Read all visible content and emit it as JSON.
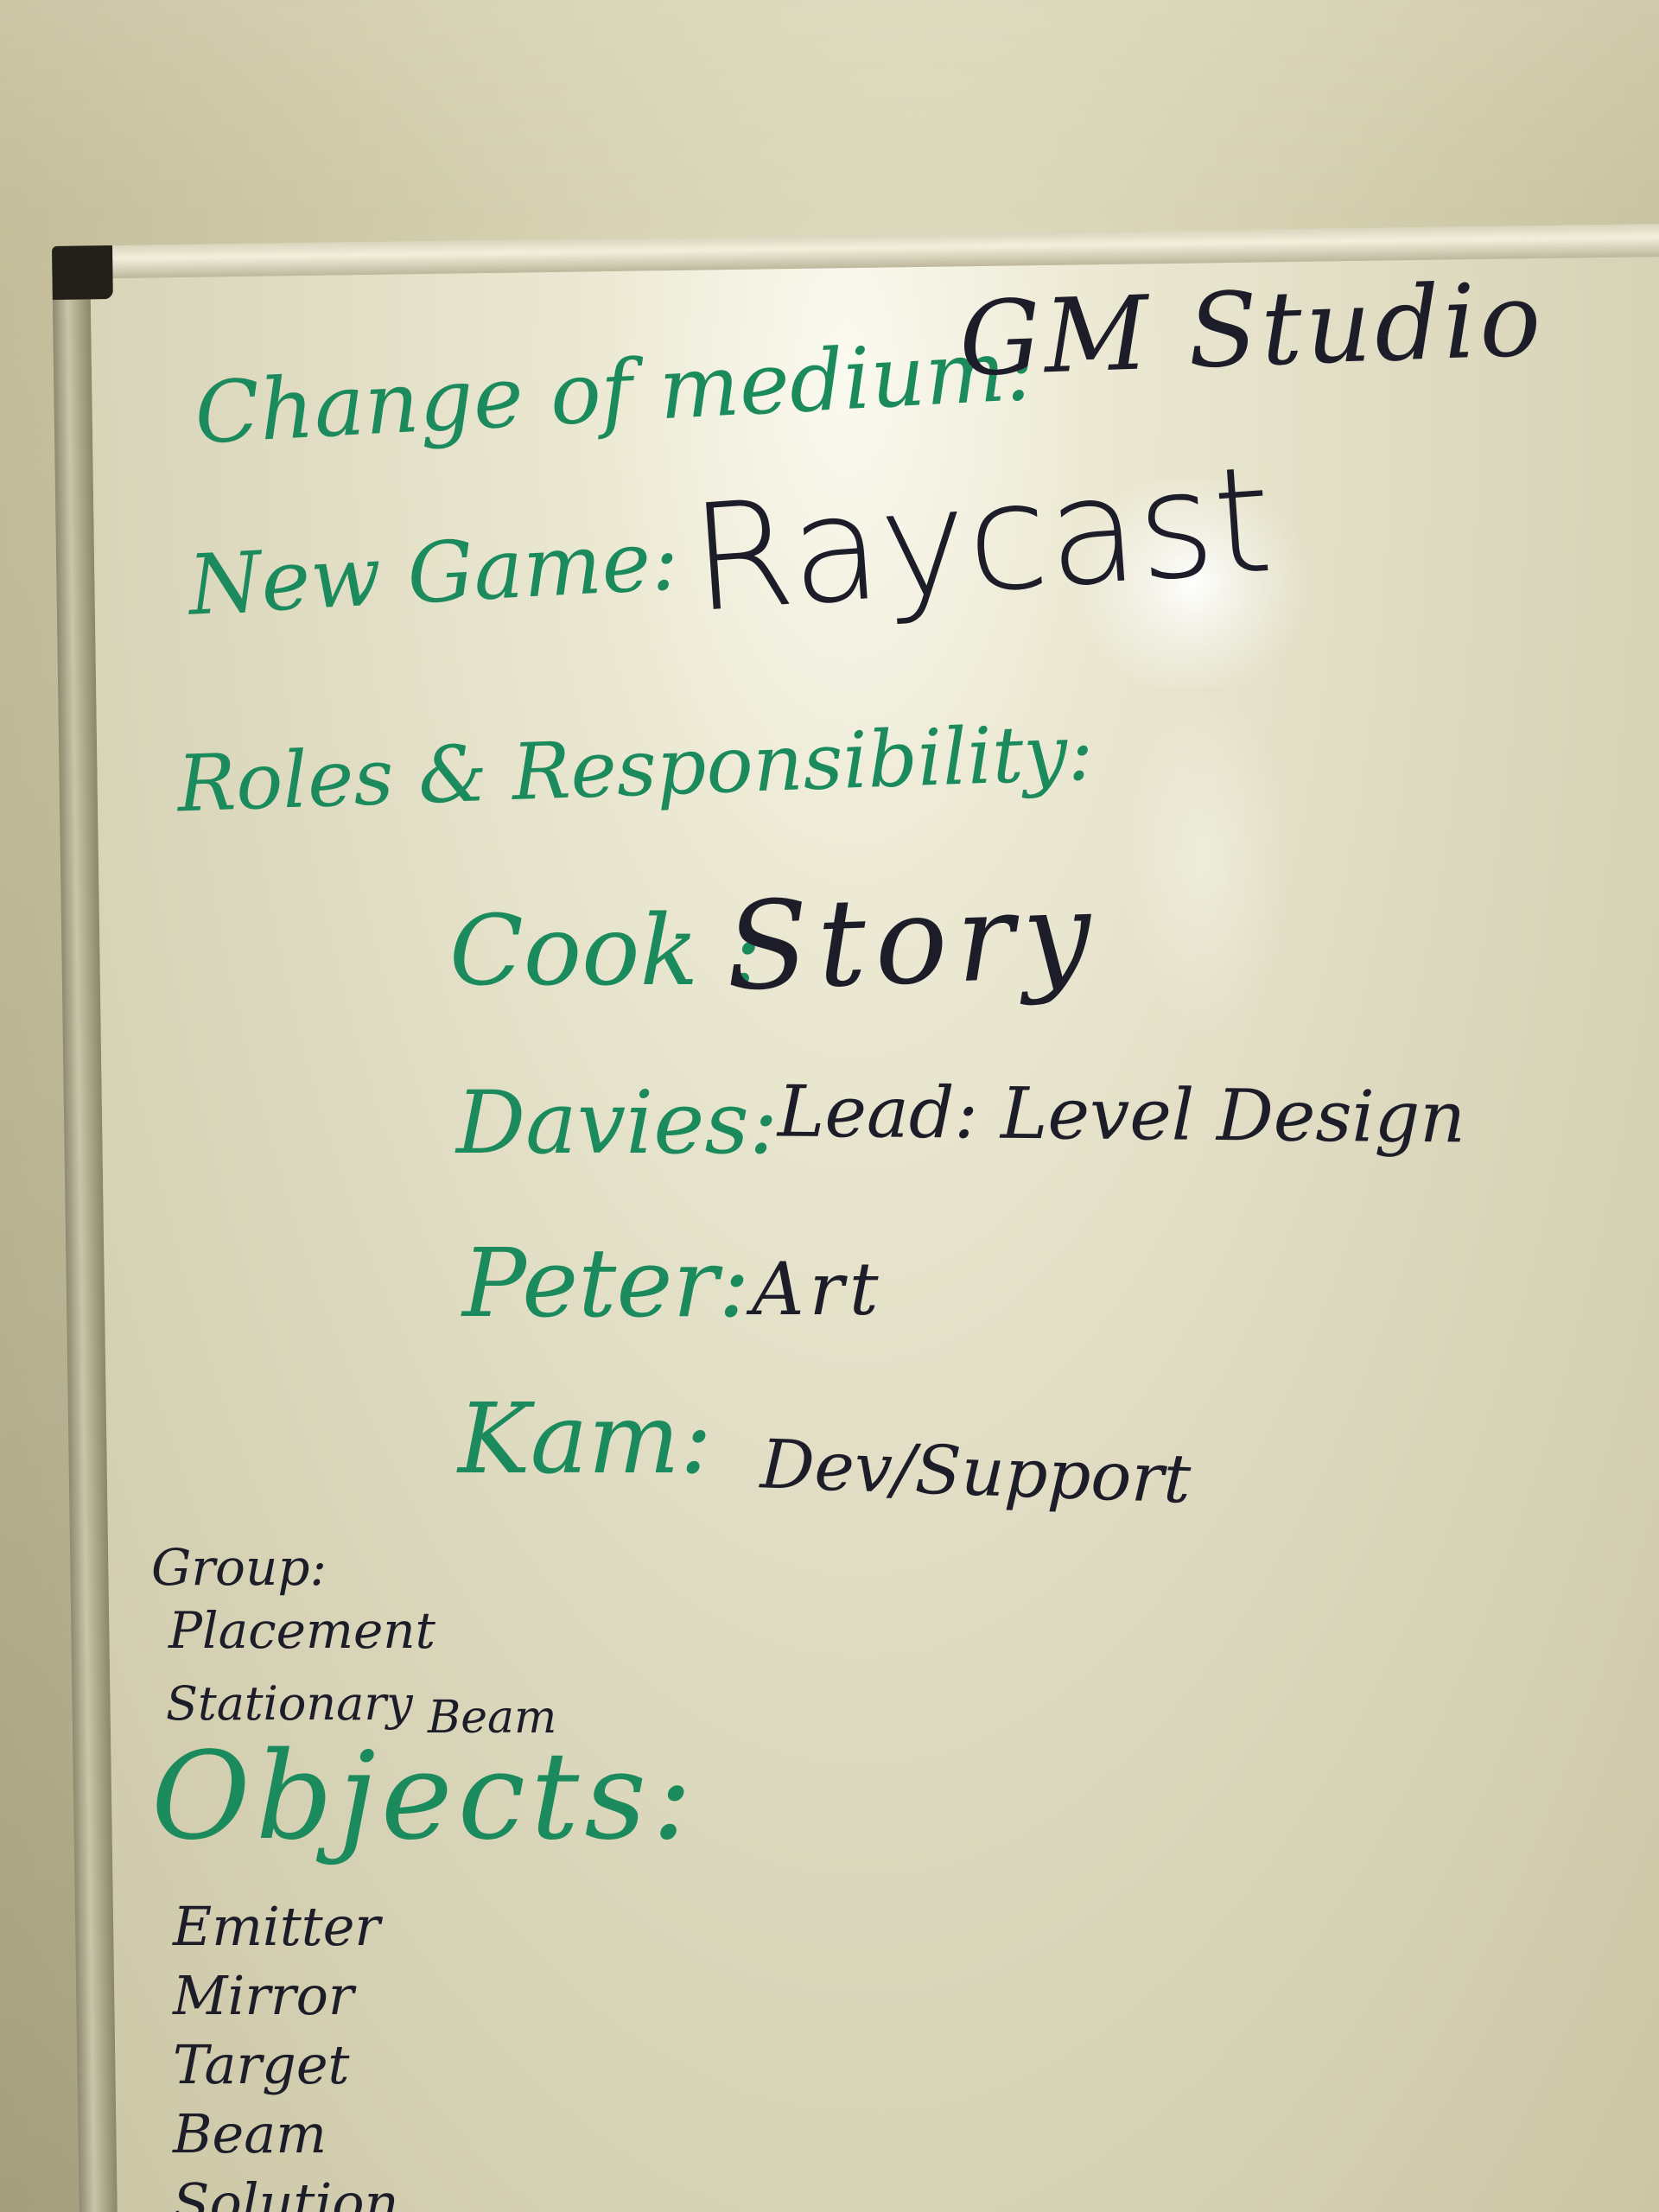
{
  "whiteboard": {
    "medium": {
      "label": "Change of medium:",
      "value": "GM Studio"
    },
    "game": {
      "label": "New Game:",
      "value": "Raycast"
    },
    "roles_heading": "Roles & Responsibility:",
    "roles": [
      {
        "name": "Cook :",
        "role": "Story"
      },
      {
        "name": "Davies:",
        "role": "Lead: Level Design"
      },
      {
        "name": "Peter:",
        "role": "Art"
      },
      {
        "name": "Kam:",
        "role": "Dev/Support"
      }
    ],
    "group_label": "Group:",
    "group_items": [
      "Placement",
      "Stationary"
    ],
    "beam_note": "Beam",
    "objects_heading": "Objects:",
    "objects": [
      "Emitter",
      "Mirror",
      "Target",
      "Beam",
      "Solution"
    ]
  }
}
